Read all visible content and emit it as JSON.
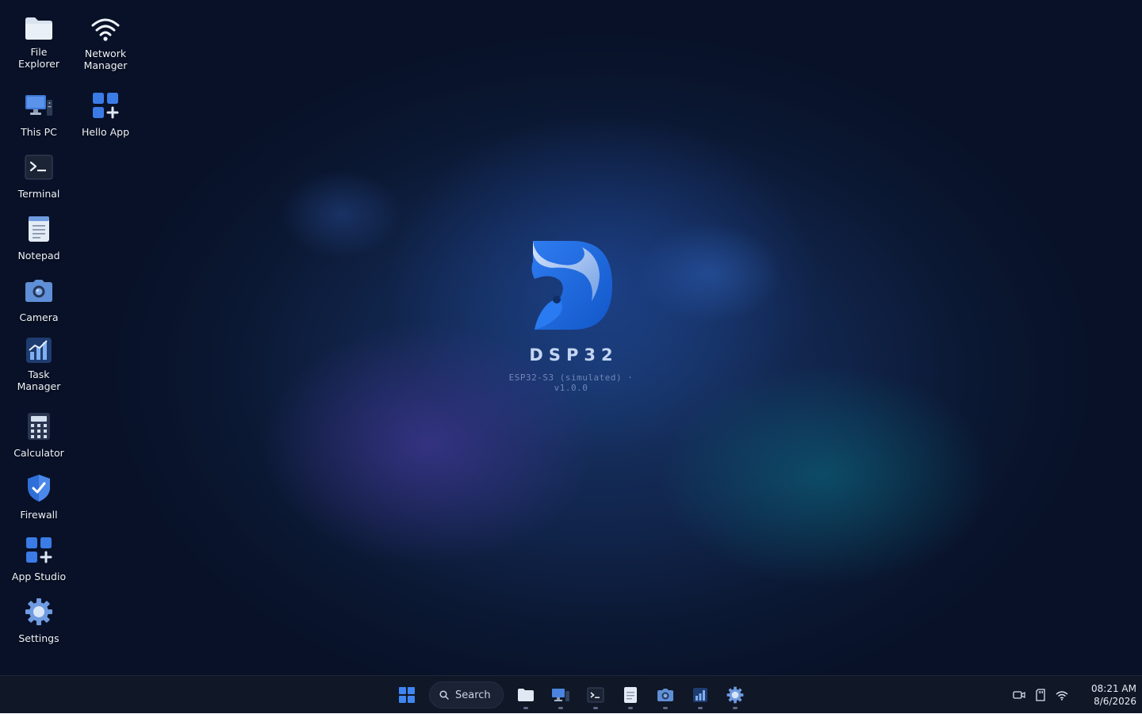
{
  "desktop": {
    "icons": [
      {
        "label": "File\nExplorer",
        "icon": "folder-icon"
      },
      {
        "label": "Network\nManager",
        "icon": "wifi-icon"
      },
      {
        "label": "This PC",
        "icon": "computer-icon"
      },
      {
        "label": "Hello App",
        "icon": "app-grid-plus-icon"
      },
      {
        "label": "Terminal",
        "icon": "terminal-icon"
      },
      {
        "label": "Notepad",
        "icon": "notepad-icon"
      },
      {
        "label": "Camera",
        "icon": "camera-icon"
      },
      {
        "label": "Task\nManager",
        "icon": "bar-chart-icon"
      },
      {
        "label": "Calculator",
        "icon": "calculator-icon"
      },
      {
        "label": "Firewall",
        "icon": "shield-check-icon"
      },
      {
        "label": "App Studio",
        "icon": "app-grid-plus-icon"
      },
      {
        "label": "Settings",
        "icon": "gear-icon"
      }
    ]
  },
  "branding": {
    "title": "DSP32",
    "subtitle": "ESP32-S3 (simulated) · v1.0.0",
    "logo_icon": "dsp32-logo",
    "accent_color": "#1f6fe0"
  },
  "taskbar": {
    "start_icon": "windows-start-icon",
    "search_placeholder": "Search",
    "pinned": [
      {
        "name": "File Explorer",
        "icon": "folder-icon"
      },
      {
        "name": "This PC",
        "icon": "computer-icon"
      },
      {
        "name": "Terminal",
        "icon": "terminal-icon"
      },
      {
        "name": "Notepad",
        "icon": "notepad-icon"
      },
      {
        "name": "Camera",
        "icon": "camera-icon"
      },
      {
        "name": "Task Manager",
        "icon": "bar-chart-icon"
      },
      {
        "name": "Settings",
        "icon": "gear-icon"
      }
    ],
    "tray": [
      "camera-video-icon",
      "sd-card-icon",
      "wifi-icon"
    ],
    "clock": {
      "time": "08:21 AM",
      "date": "8/6/2026"
    }
  }
}
